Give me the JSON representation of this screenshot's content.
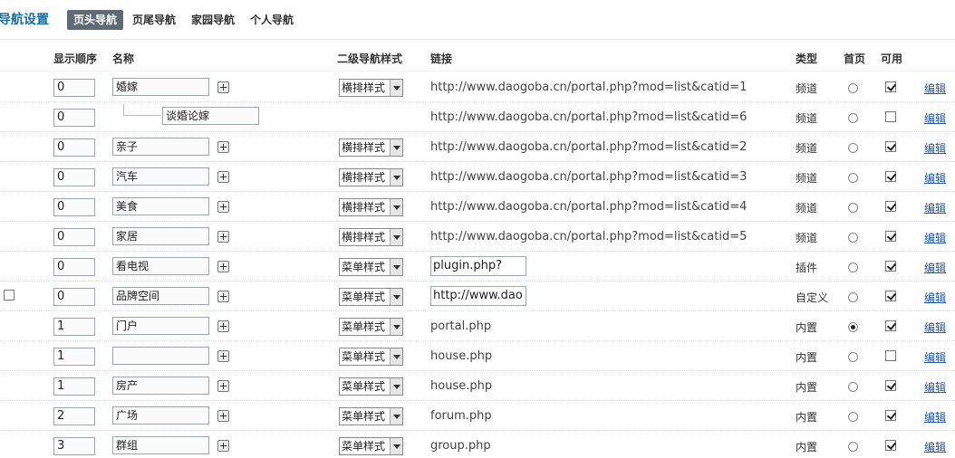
{
  "page_title": "导航设置",
  "tabs": [
    {
      "label": "页头导航",
      "active": true
    },
    {
      "label": "页尾导航",
      "active": false
    },
    {
      "label": "家园导航",
      "active": false
    },
    {
      "label": "个人导航",
      "active": false
    }
  ],
  "headers": {
    "order": "显示顺序",
    "name": "名称",
    "style": "二级导航样式",
    "link": "链接",
    "type": "类型",
    "home": "首页",
    "enabled": "可用"
  },
  "rows": [
    {
      "order": "0",
      "name": "婚嫁",
      "child": false,
      "style": "横排样式",
      "link": "http://www.daogoba.cn/portal.php?mod=list&catid=1",
      "link_editable": false,
      "type": "频道",
      "home": false,
      "enabled": true,
      "left_check": false,
      "edit": "编辑"
    },
    {
      "order": "0",
      "name": "谈婚论嫁",
      "child": true,
      "style": "",
      "link": "http://www.daogoba.cn/portal.php?mod=list&catid=6",
      "link_editable": false,
      "type": "频道",
      "home": false,
      "enabled": false,
      "left_check": false,
      "edit": "编辑"
    },
    {
      "order": "0",
      "name": "亲子",
      "child": false,
      "style": "横排样式",
      "link": "http://www.daogoba.cn/portal.php?mod=list&catid=2",
      "link_editable": false,
      "type": "频道",
      "home": false,
      "enabled": true,
      "left_check": false,
      "edit": "编辑"
    },
    {
      "order": "0",
      "name": "汽车",
      "child": false,
      "style": "横排样式",
      "link": "http://www.daogoba.cn/portal.php?mod=list&catid=3",
      "link_editable": false,
      "type": "频道",
      "home": false,
      "enabled": true,
      "left_check": false,
      "edit": "编辑"
    },
    {
      "order": "0",
      "name": "美食",
      "child": false,
      "style": "横排样式",
      "link": "http://www.daogoba.cn/portal.php?mod=list&catid=4",
      "link_editable": false,
      "type": "频道",
      "home": false,
      "enabled": true,
      "left_check": false,
      "edit": "编辑"
    },
    {
      "order": "0",
      "name": "家居",
      "child": false,
      "style": "横排样式",
      "link": "http://www.daogoba.cn/portal.php?mod=list&catid=5",
      "link_editable": false,
      "type": "频道",
      "home": false,
      "enabled": true,
      "left_check": false,
      "edit": "编辑"
    },
    {
      "order": "0",
      "name": "看电视",
      "child": false,
      "style": "菜单样式",
      "link": "plugin.php?id=ti",
      "link_editable": true,
      "type": "插件",
      "home": false,
      "enabled": true,
      "left_check": false,
      "edit": "编辑"
    },
    {
      "order": "0",
      "name": "品牌空间",
      "child": false,
      "style": "菜单样式",
      "link": "http://www.dao",
      "link_editable": true,
      "type": "自定义",
      "home": false,
      "enabled": true,
      "left_check": true,
      "edit": "编辑"
    },
    {
      "order": "1",
      "name": "门户",
      "child": false,
      "style": "菜单样式",
      "link": "portal.php",
      "link_editable": false,
      "type": "内置",
      "home": true,
      "enabled": true,
      "left_check": false,
      "edit": "编辑"
    },
    {
      "order": "1",
      "name": "",
      "child": false,
      "style": "菜单样式",
      "link": "house.php",
      "link_editable": false,
      "type": "内置",
      "home": false,
      "enabled": false,
      "left_check": false,
      "edit": "编辑"
    },
    {
      "order": "1",
      "name": "房产",
      "child": false,
      "style": "菜单样式",
      "link": "house.php",
      "link_editable": false,
      "type": "内置",
      "home": false,
      "enabled": true,
      "left_check": false,
      "edit": "编辑"
    },
    {
      "order": "2",
      "name": "广场",
      "child": false,
      "style": "菜单样式",
      "link": "forum.php",
      "link_editable": false,
      "type": "内置",
      "home": false,
      "enabled": true,
      "left_check": false,
      "edit": "编辑"
    },
    {
      "order": "3",
      "name": "群组",
      "child": false,
      "style": "菜单样式",
      "link": "group.php",
      "link_editable": false,
      "type": "内置",
      "home": false,
      "enabled": true,
      "left_check": false,
      "edit": "编辑"
    }
  ]
}
